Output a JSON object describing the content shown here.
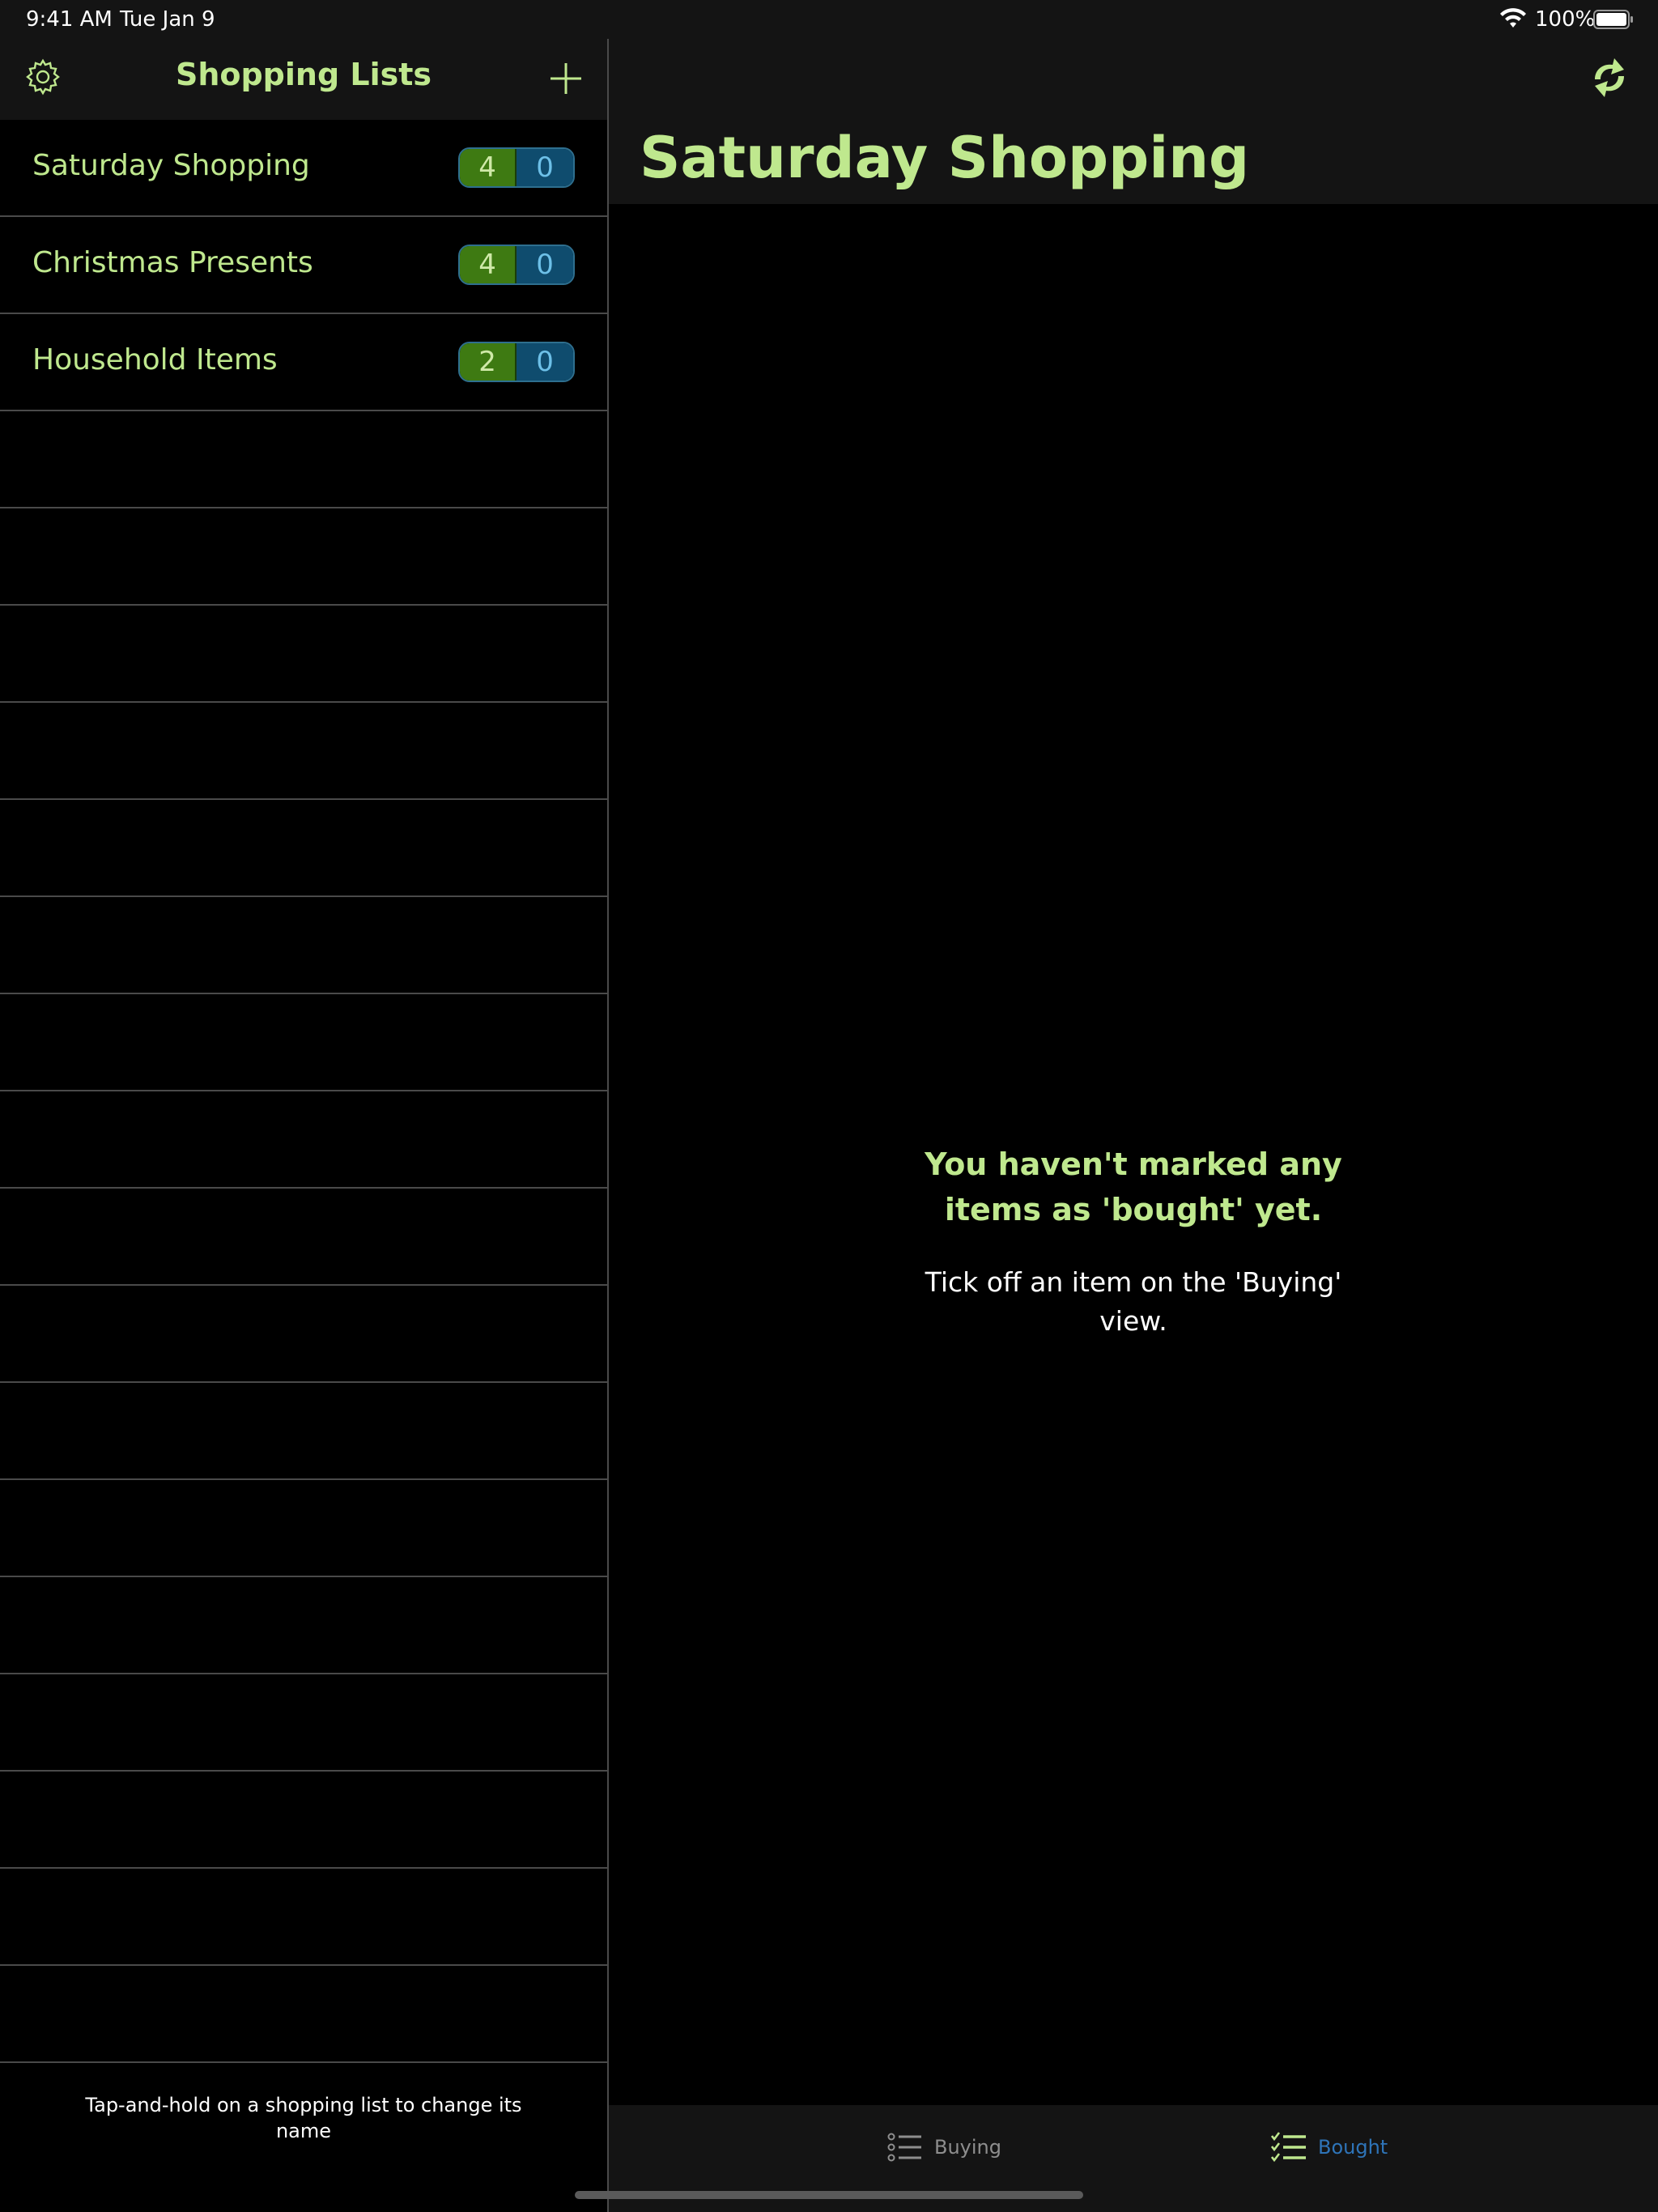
{
  "status_bar": {
    "time": "9:41 AM",
    "date": "Tue Jan 9",
    "battery": "100%"
  },
  "sidebar": {
    "title": "Shopping Lists",
    "settings_icon": "gear-icon",
    "add_icon": "plus-icon",
    "lists": [
      {
        "name": "Saturday Shopping",
        "buying": "4",
        "bought": "0"
      },
      {
        "name": "Christmas Presents",
        "buying": "4",
        "bought": "0"
      },
      {
        "name": "Household Items",
        "buying": "2",
        "bought": "0"
      }
    ],
    "hint": "Tap-and-hold on a shopping list to change its name"
  },
  "detail": {
    "title": "Saturday Shopping",
    "sync_icon": "sync-icon",
    "empty_heading": "You haven't marked any items as 'bought' yet.",
    "empty_subtext": "Tick off an item on the 'Buying' view."
  },
  "tabs": {
    "buying_label": "Buying",
    "bought_label": "Bought",
    "selected": "Bought"
  },
  "colors": {
    "accent_green": "#bfe88e",
    "buying_badge": "#3e7a12",
    "bought_badge": "#0f4c6e",
    "tab_selected": "#2e74b8"
  }
}
